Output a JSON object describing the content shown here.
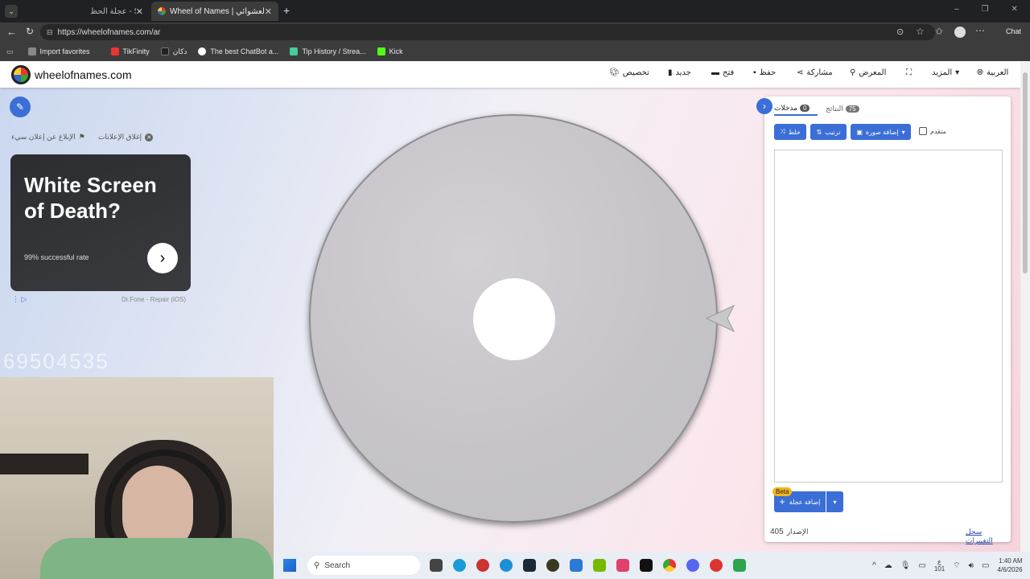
{
  "browser": {
    "tabs": [
      {
        "label": "عجلة الحظ - Search"
      },
      {
        "label": "Wheel of Names | الاسم العشوائي ..."
      }
    ],
    "url": "https://wheelofnames.com/ar",
    "chat_label": "Chat",
    "bookmarks": [
      "Import favorites",
      "TikFinity",
      "دكان",
      "The best ChatBot a...",
      "Tip History / Strea...",
      "Kick"
    ]
  },
  "site": {
    "logo_text": "wheelofnames.com",
    "nav": {
      "customize": "تخصيص",
      "new": "جديد",
      "open": "فتح",
      "save": "حفظ",
      "share": "مشاركة",
      "gallery": "المعرض",
      "more": "المزيد",
      "language": "العربية"
    },
    "ad": {
      "report": "الإبلاغ عن إعلان سيء",
      "close": "إغلاق الإعلانات",
      "headline": "White Screen of Death?",
      "subtext": "99% successful rate",
      "source": "Dr.Fone - Repair (iOS)"
    },
    "overlay_digits": "69504535"
  },
  "panel": {
    "entries_tab": "مدخلات",
    "entries_count": "0",
    "results_tab": "النتائج",
    "results_count": "75",
    "shuffle": "خلط",
    "sort": "ترتيب",
    "add_image": "إضافة صورة",
    "advanced": "متقدم",
    "beta": "Beta",
    "add_wheel": "إضافة عجلة",
    "version_label": "الإصدار",
    "version_value": "405",
    "changelog": "سجل التغييرات"
  },
  "taskbar": {
    "search": "Search",
    "lang_top": "ع",
    "lang_bottom": "101",
    "time": "1:40 AM",
    "date": "4/6/2026"
  },
  "colors": {
    "accent": "#3b6ed6",
    "tabstrip": "#202124",
    "chrome": "#3c3c3c"
  }
}
